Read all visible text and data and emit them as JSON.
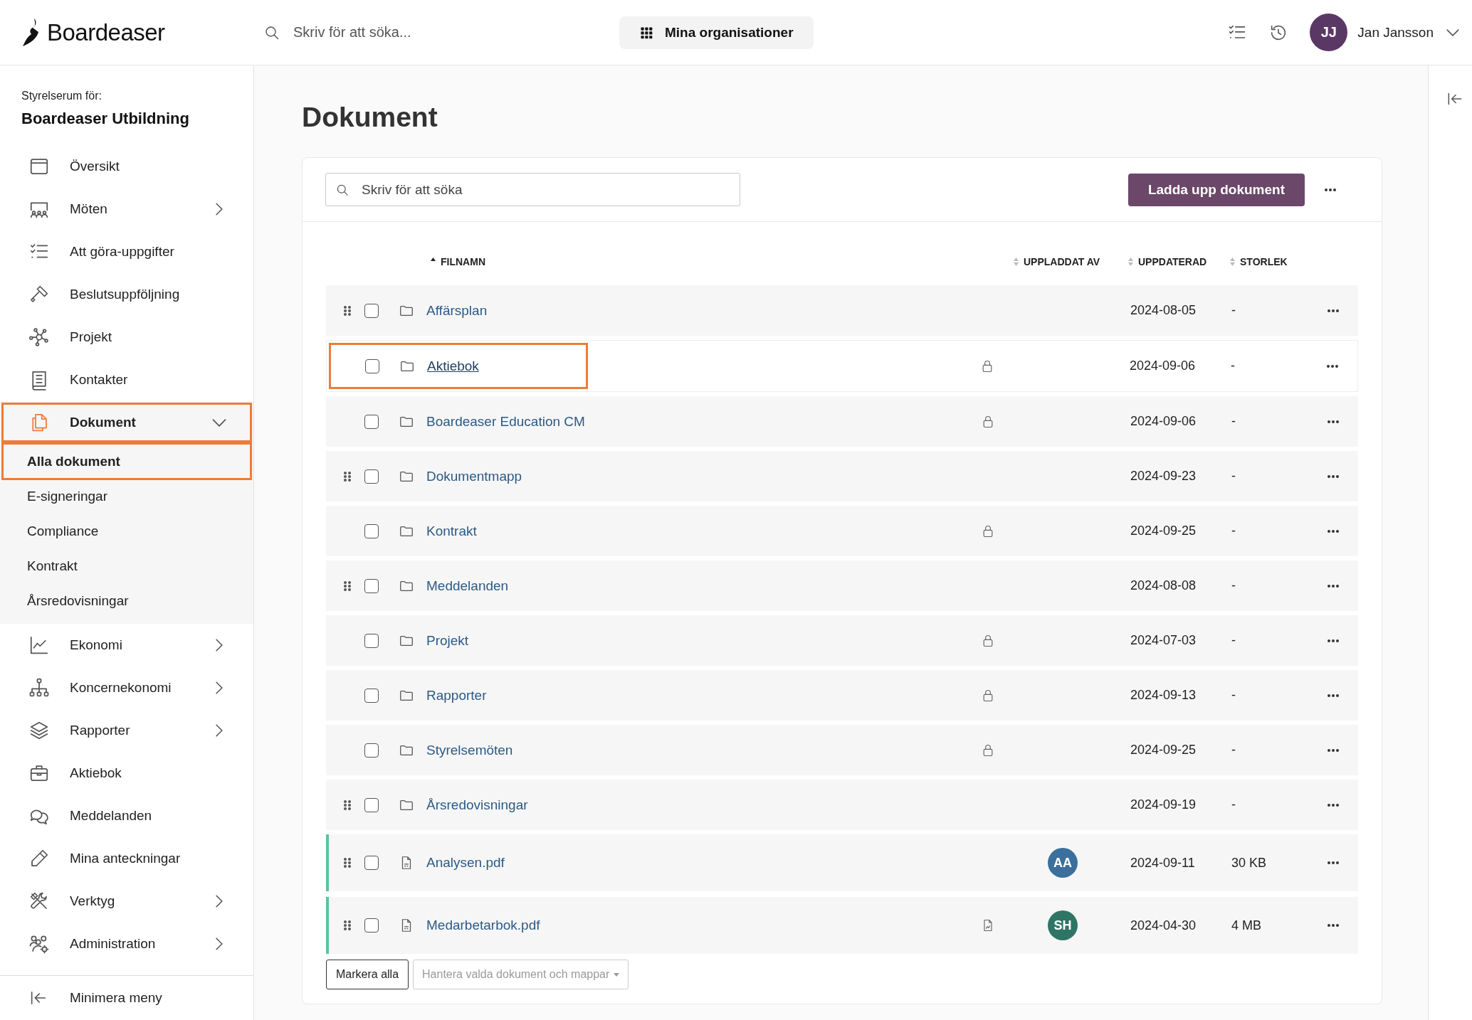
{
  "header": {
    "logo": "Boardeaser",
    "search_placeholder": "Skriv för att söka...",
    "org_button": "Mina organisationer",
    "user": {
      "initials": "JJ",
      "name": "Jan Jansson"
    }
  },
  "sidebar": {
    "caption": "Styrelserum för:",
    "org": "Boardeaser Utbildning",
    "items": [
      {
        "label": "Översikt",
        "expandable": false,
        "selected": false,
        "highlighted": false
      },
      {
        "label": "Möten",
        "expandable": true,
        "expanded": false,
        "selected": false,
        "highlighted": false
      },
      {
        "label": "Att göra-uppgifter",
        "expandable": false,
        "selected": false,
        "highlighted": false
      },
      {
        "label": "Beslutsuppföljning",
        "expandable": false,
        "selected": false,
        "highlighted": false
      },
      {
        "label": "Projekt",
        "expandable": false,
        "selected": false,
        "highlighted": false
      },
      {
        "label": "Kontakter",
        "expandable": false,
        "selected": false,
        "highlighted": false
      },
      {
        "label": "Dokument",
        "expandable": true,
        "expanded": true,
        "selected": true,
        "highlighted": true,
        "children": [
          {
            "label": "Alla dokument",
            "selected": true,
            "highlighted": true
          },
          {
            "label": "E-signeringar",
            "selected": false,
            "highlighted": false
          },
          {
            "label": "Compliance",
            "selected": false,
            "highlighted": false
          },
          {
            "label": "Kontrakt",
            "selected": false,
            "highlighted": false
          },
          {
            "label": "Årsredovisningar",
            "selected": false,
            "highlighted": false
          }
        ]
      },
      {
        "label": "Ekonomi",
        "expandable": true,
        "expanded": false,
        "selected": false,
        "highlighted": false
      },
      {
        "label": "Koncernekonomi",
        "expandable": true,
        "expanded": false,
        "selected": false,
        "highlighted": false
      },
      {
        "label": "Rapporter",
        "expandable": true,
        "expanded": false,
        "selected": false,
        "highlighted": false
      },
      {
        "label": "Aktiebok",
        "expandable": false,
        "selected": false,
        "highlighted": false
      },
      {
        "label": "Meddelanden",
        "expandable": false,
        "selected": false,
        "highlighted": false
      },
      {
        "label": "Mina anteckningar",
        "expandable": false,
        "selected": false,
        "highlighted": false
      },
      {
        "label": "Verktyg",
        "expandable": true,
        "expanded": false,
        "selected": false,
        "highlighted": false
      },
      {
        "label": "Administration",
        "expandable": true,
        "expanded": false,
        "selected": false,
        "highlighted": false
      }
    ],
    "footer": "Minimera meny"
  },
  "main": {
    "title": "Dokument",
    "search_placeholder": "Skriv för att söka",
    "upload_button": "Ladda upp dokument",
    "columns": [
      {
        "label": "FILNAMN",
        "sorted": true
      },
      {
        "label": "UPPLADDAT AV",
        "sorted": false
      },
      {
        "label": "UPPDATERAD",
        "sorted": false
      },
      {
        "label": "STORLEK",
        "sorted": false
      }
    ],
    "rows": [
      {
        "kind": "folder",
        "name": "Affärsplan",
        "draggable": true,
        "checked": false,
        "highlighted": false,
        "locked": false,
        "attachment": false,
        "date": "2024-08-05",
        "size": "-"
      },
      {
        "kind": "folder",
        "name": "Aktiebok",
        "draggable": false,
        "checked": false,
        "highlighted": true,
        "locked": true,
        "attachment": false,
        "date": "2024-09-06",
        "size": "-"
      },
      {
        "kind": "folder",
        "name": "Boardeaser Education CM",
        "draggable": false,
        "checked": false,
        "highlighted": false,
        "locked": true,
        "attachment": false,
        "date": "2024-09-06",
        "size": "-"
      },
      {
        "kind": "folder",
        "name": "Dokumentmapp",
        "draggable": true,
        "checked": false,
        "highlighted": false,
        "locked": false,
        "attachment": false,
        "date": "2024-09-23",
        "size": "-"
      },
      {
        "kind": "folder",
        "name": "Kontrakt",
        "draggable": false,
        "checked": false,
        "highlighted": false,
        "locked": true,
        "attachment": false,
        "date": "2024-09-25",
        "size": "-"
      },
      {
        "kind": "folder",
        "name": "Meddelanden",
        "draggable": true,
        "checked": false,
        "highlighted": false,
        "locked": false,
        "attachment": false,
        "date": "2024-08-08",
        "size": "-"
      },
      {
        "kind": "folder",
        "name": "Projekt",
        "draggable": false,
        "checked": false,
        "highlighted": false,
        "locked": true,
        "attachment": false,
        "date": "2024-07-03",
        "size": "-"
      },
      {
        "kind": "folder",
        "name": "Rapporter",
        "draggable": false,
        "checked": false,
        "highlighted": false,
        "locked": true,
        "attachment": false,
        "date": "2024-09-13",
        "size": "-"
      },
      {
        "kind": "folder",
        "name": "Styrelsemöten",
        "draggable": false,
        "checked": false,
        "highlighted": false,
        "locked": true,
        "attachment": false,
        "date": "2024-09-25",
        "size": "-"
      },
      {
        "kind": "folder",
        "name": "Årsredovisningar",
        "draggable": true,
        "checked": false,
        "highlighted": false,
        "locked": false,
        "attachment": false,
        "date": "2024-09-19",
        "size": "-"
      },
      {
        "kind": "pdf",
        "name": "Analysen.pdf",
        "draggable": true,
        "checked": false,
        "highlighted": false,
        "locked": false,
        "attachment": false,
        "uploader": {
          "initials": "AA",
          "color": "#3b6f9c"
        },
        "date": "2024-09-11",
        "size": "30 KB"
      },
      {
        "kind": "pdf",
        "name": "Medarbetarbok.pdf",
        "draggable": true,
        "checked": false,
        "highlighted": false,
        "locked": false,
        "attachment": true,
        "uploader": {
          "initials": "SH",
          "color": "#2f7566"
        },
        "date": "2024-04-30",
        "size": "4 MB"
      }
    ],
    "select_all_button": "Markera alla",
    "bulk_menu": {
      "label": "Hantera valda dokument och mappar",
      "disabled": true
    }
  }
}
